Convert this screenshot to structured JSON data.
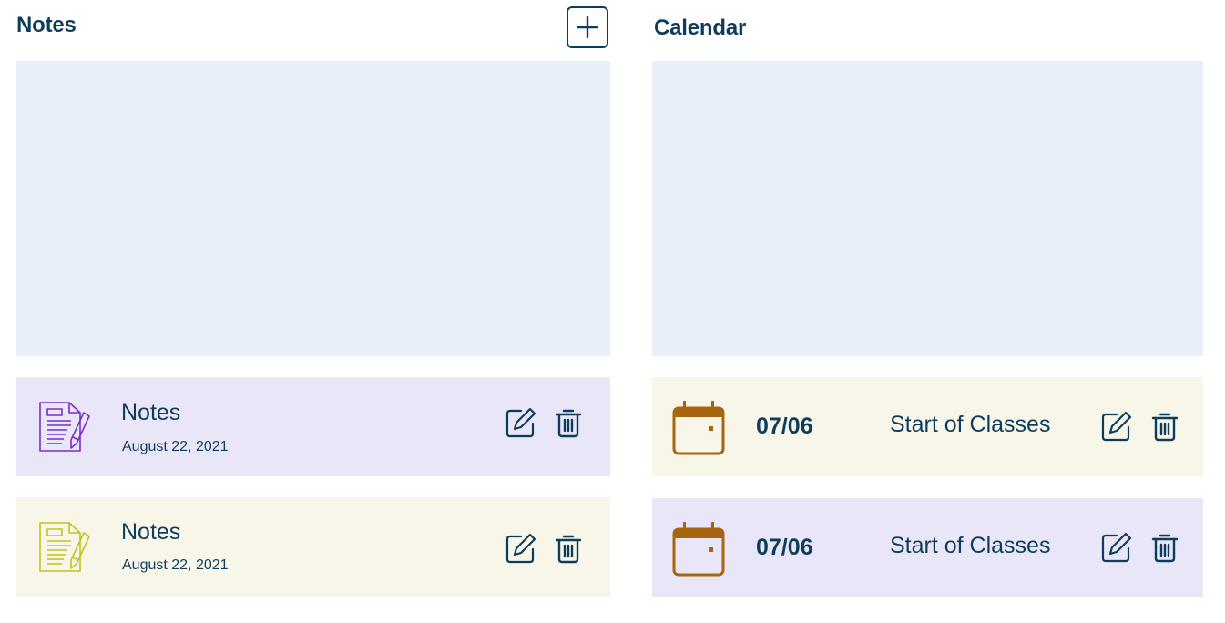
{
  "notes": {
    "title": "Notes",
    "add_icon": "plus-icon",
    "items": [
      {
        "title": "Notes",
        "date": "August 22, 2021",
        "color": "#7b2fc4",
        "bg": "#e9e6f8"
      },
      {
        "title": "Notes",
        "date": "August 22, 2021",
        "color": "#c2c31e",
        "bg": "#f8f6e8"
      }
    ]
  },
  "calendar": {
    "title": "Calendar",
    "items": [
      {
        "date": "07/06",
        "event": "Start of Classes",
        "icon_color": "#a8650f",
        "bg": "#f8f6e8"
      },
      {
        "date": "07/06",
        "event": "Start of Classes",
        "icon_color": "#a8650f",
        "bg": "#e9e6f8"
      }
    ]
  },
  "icons": {
    "edit": "pencil-square-icon",
    "delete": "trash-icon"
  },
  "colors": {
    "text": "#0e3d5c",
    "panel": "#e7eff9"
  }
}
